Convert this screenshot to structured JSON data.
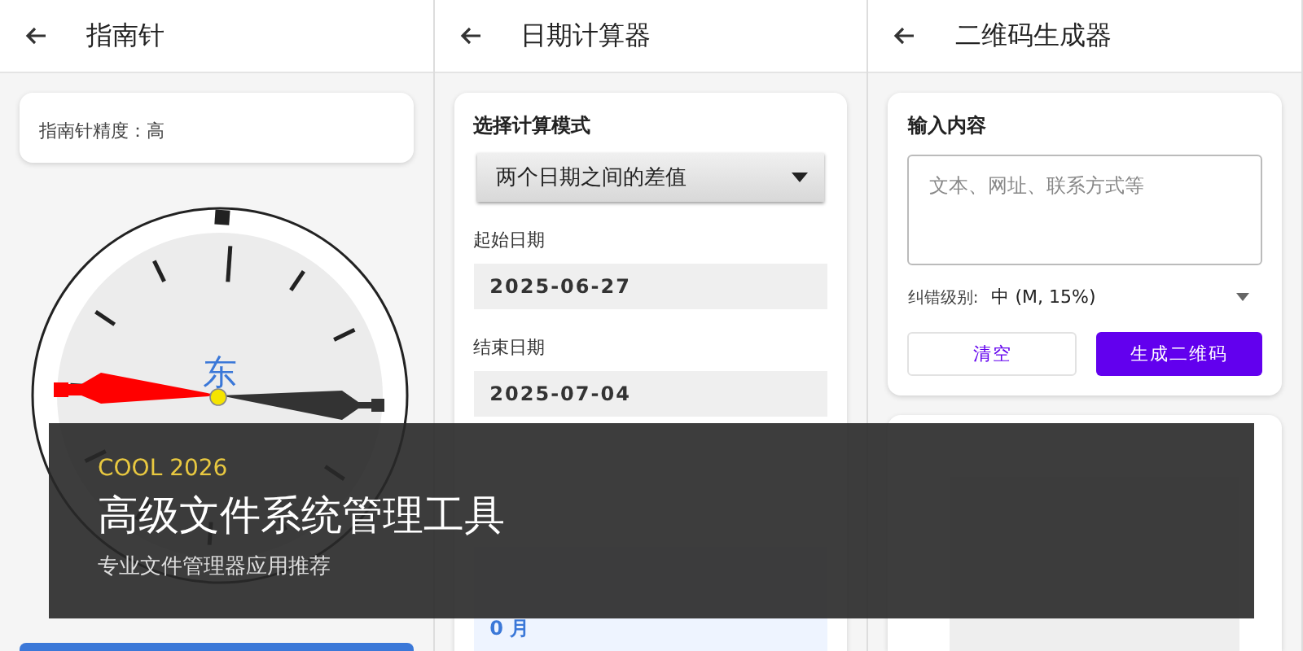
{
  "panels": [
    {
      "kind": "compass",
      "title": "指南针",
      "accuracy": "指南针精度：高",
      "direction": "东"
    },
    {
      "kind": "date",
      "title": "日期计算器",
      "mode_label": "选择计算模式",
      "mode": "两个日期之间的差值",
      "start_label": "起始日期",
      "start": "2025-06-27",
      "end_label": "结束日期",
      "end": "2025-07-04",
      "results": [
        "0 月"
      ]
    },
    {
      "kind": "qr",
      "title": "二维码生成器",
      "input_label": "输入内容",
      "placeholder": "文本、网址、联系方式等",
      "level_label": "纠错级别:",
      "level_value": "中 (M, 15%)",
      "buttons": [
        "清空",
        "生成二维码"
      ]
    }
  ],
  "banner": {
    "tag": "COOL 2026",
    "title": "高级文件系统管理工具",
    "subtitle": "专业文件管理器应用推荐"
  }
}
